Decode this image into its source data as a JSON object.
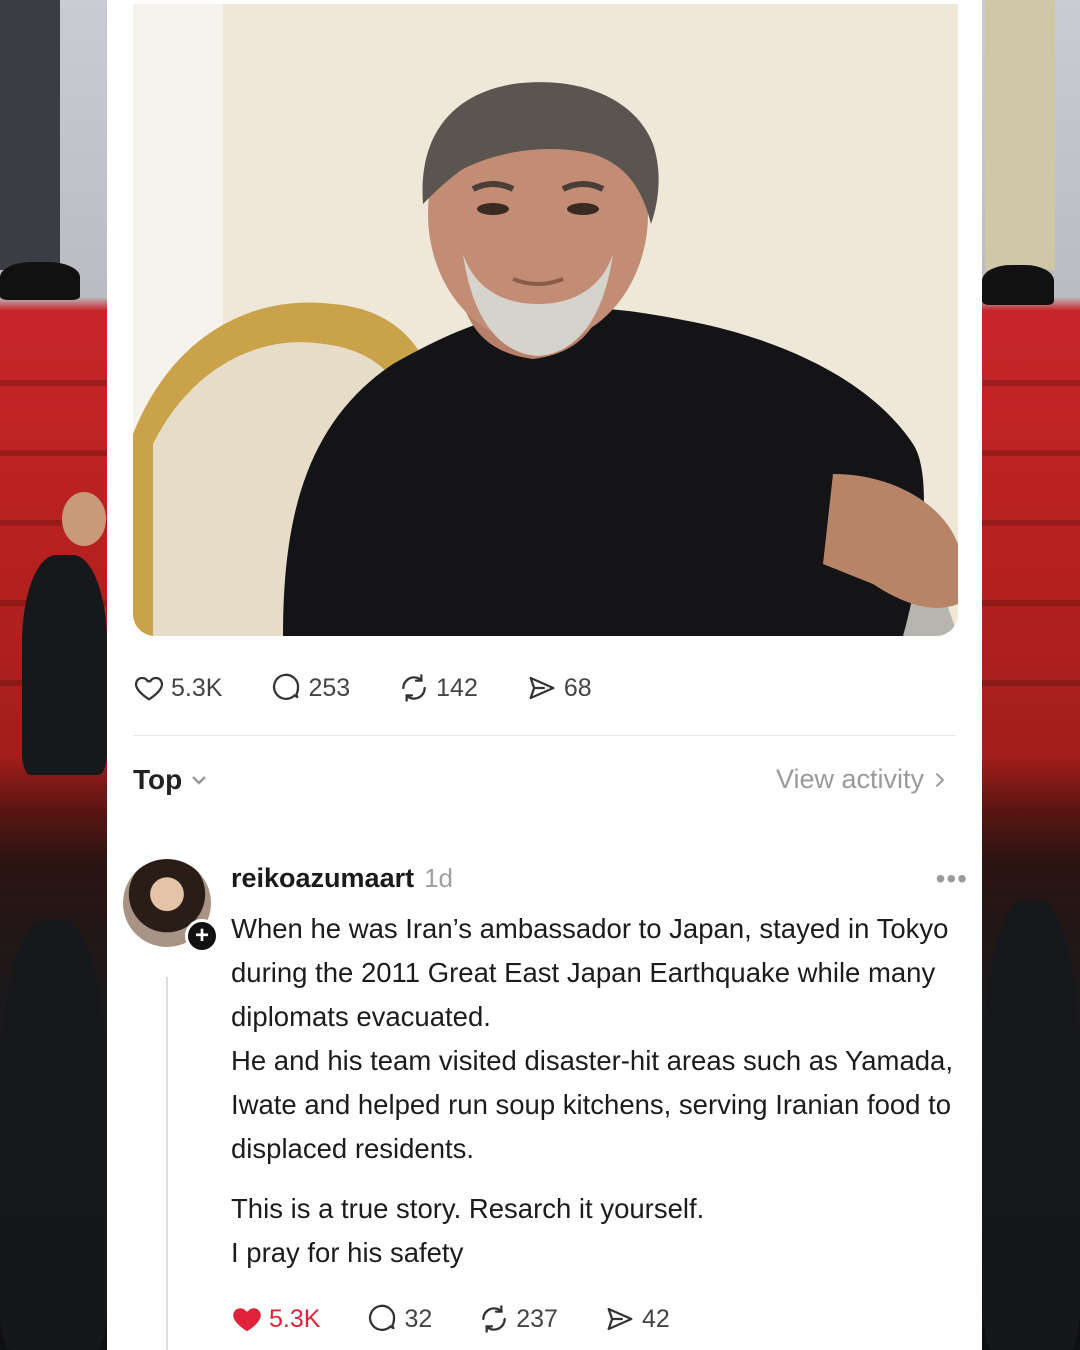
{
  "post": {
    "stats": {
      "likes": "5.3K",
      "replies": "253",
      "reposts": "142",
      "shares": "68"
    }
  },
  "replies_header": {
    "sort_label": "Top",
    "view_activity": "View activity"
  },
  "comment": {
    "username": "reikoazumaart",
    "time": "1d",
    "more": "•••",
    "follow_symbol": "+",
    "paragraphs": [
      "When he was Iran’s ambassador to Japan, stayed in Tokyo during the 2011 Great East Japan Earthquake while many diplomats evacuated.",
      "He and his team visited disaster-hit areas such as Yamada, Iwate and helped run soup kitchens, serving Iranian food to displaced residents.",
      "This is a true story.  Resarch it yourself.",
      "I pray for his safety"
    ],
    "stats": {
      "likes": "5.3K",
      "replies": "32",
      "reposts": "237",
      "shares": "42"
    },
    "liked": true
  },
  "colors": {
    "like_active": "#e0233a",
    "muted": "#9a9a9a"
  },
  "icons": [
    "heart-icon",
    "comment-icon",
    "repost-icon",
    "share-icon",
    "chevron-down-icon",
    "chevron-right-icon",
    "more-icon",
    "follow-plus-icon"
  ]
}
